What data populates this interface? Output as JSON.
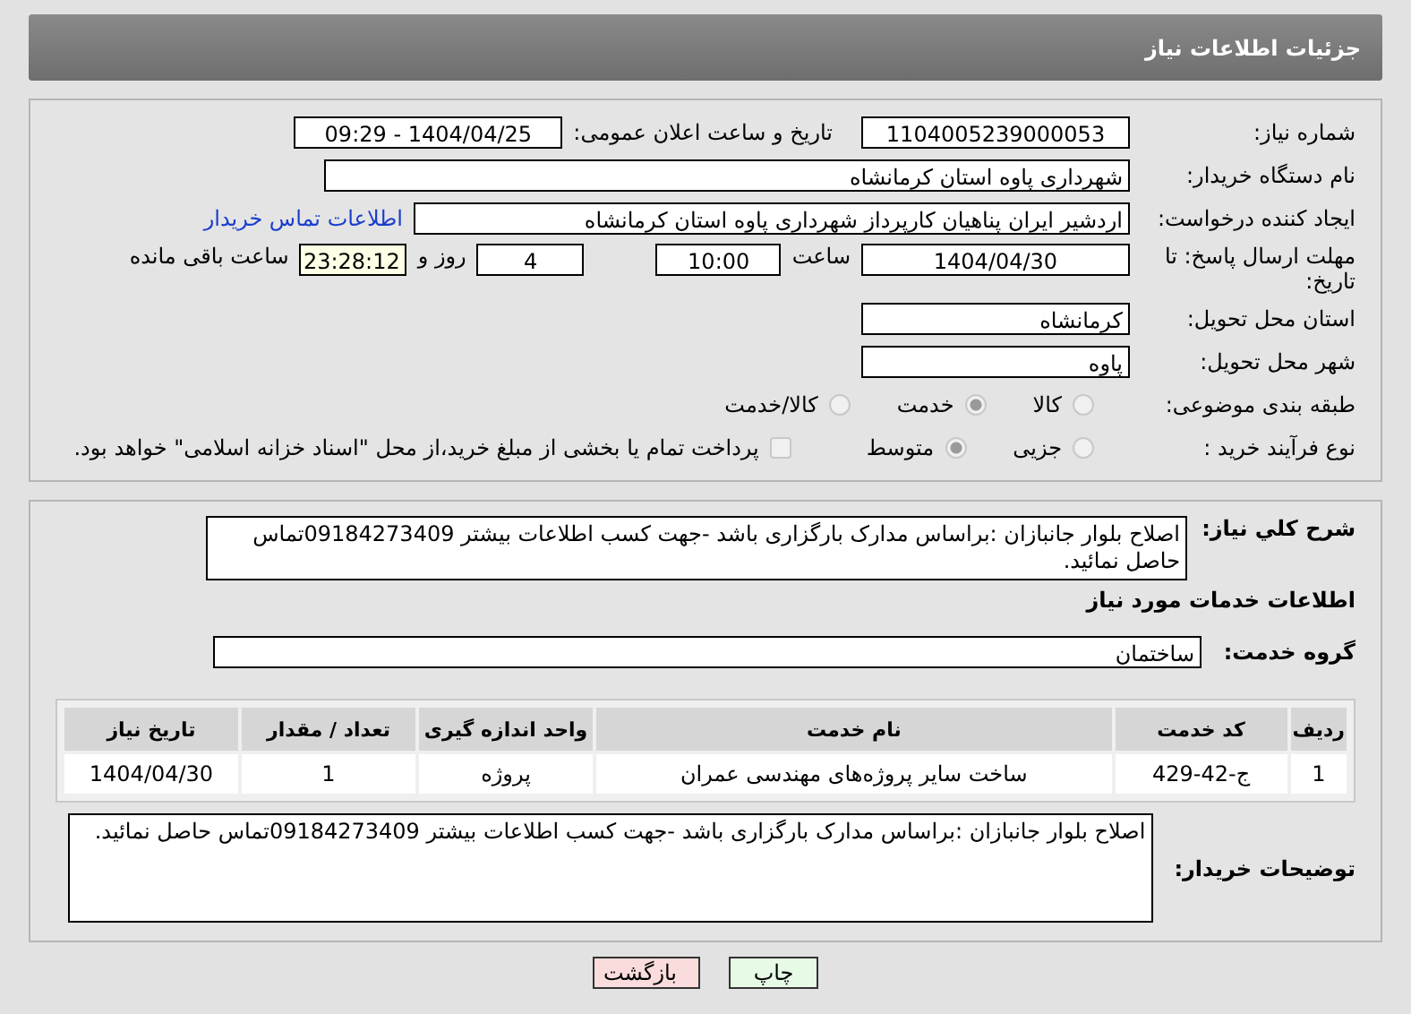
{
  "header": {
    "title": "جزئیات اطلاعات نیاز"
  },
  "general": {
    "need_number": {
      "label": "شماره نیاز:",
      "value": "1104005239000053"
    },
    "announce": {
      "label": "تاریخ و ساعت اعلان عمومی:",
      "value": "1404/04/25 - 09:29"
    },
    "buyer_org": {
      "label": "نام دستگاه خریدار:",
      "value": "شهرداری پاوه استان کرمانشاه"
    },
    "requester": {
      "label": "ایجاد کننده درخواست:",
      "value": "اردشیر ایران پناهیان کارپرداز شهرداری پاوه استان کرمانشاه",
      "link": "اطلاعات تماس خریدار"
    },
    "deadline": {
      "label": "مهلت ارسال پاسخ: تا تاریخ:",
      "date": "1404/04/30",
      "time_label": "ساعت",
      "time": "10:00",
      "days": "4",
      "days_label": "روز و",
      "remaining": "23:28:12",
      "remaining_label": "ساعت باقی مانده"
    },
    "province": {
      "label": "استان محل تحویل:",
      "value": "کرمانشاه"
    },
    "city": {
      "label": "شهر محل تحویل:",
      "value": "پاوه"
    },
    "category": {
      "label": "طبقه بندی موضوعی:",
      "options": [
        {
          "label": "کالا",
          "selected": false
        },
        {
          "label": "خدمت",
          "selected": true
        },
        {
          "label": "کالا/خدمت",
          "selected": false
        }
      ]
    },
    "process": {
      "label": "نوع فرآیند خرید :",
      "options": [
        {
          "label": "جزیی",
          "selected": false
        },
        {
          "label": "متوسط",
          "selected": true
        }
      ],
      "payment": {
        "label": "پرداخت تمام یا بخشی از مبلغ خرید،از محل \"اسناد خزانه اسلامی\" خواهد بود.",
        "checked": false
      }
    }
  },
  "services": {
    "description": {
      "label": "شرح کلي نياز:",
      "value": "اصلاح بلوار جانبازان :براساس مدارک بارگزاری باشد -جهت کسب اطلاعات بیشتر 09184273409تماس حاصل نمائید."
    },
    "section_title": "اطلاعات خدمات مورد نیاز",
    "group": {
      "label": "گروه خدمت:",
      "value": "ساختمان"
    },
    "table": {
      "columns": [
        "ردیف",
        "کد خدمت",
        "نام خدمت",
        "واحد اندازه گیری",
        "تعداد / مقدار",
        "تاریخ نیاز"
      ],
      "rows": [
        [
          "1",
          "ج-42-429",
          "ساخت سایر پروژه‌های مهندسی عمران",
          "پروژه",
          "1",
          "1404/04/30"
        ]
      ]
    },
    "buyer_notes": {
      "label": "توضیحات خریدار:",
      "value": "اصلاح بلوار جانبازان :براساس مدارک بارگزاری باشد -جهت کسب اطلاعات بیشتر 09184273409تماس حاصل نمائید."
    }
  },
  "buttons": [
    {
      "label": "چاپ",
      "kind": "print"
    },
    {
      "label": "بازگشت",
      "kind": "back"
    }
  ]
}
